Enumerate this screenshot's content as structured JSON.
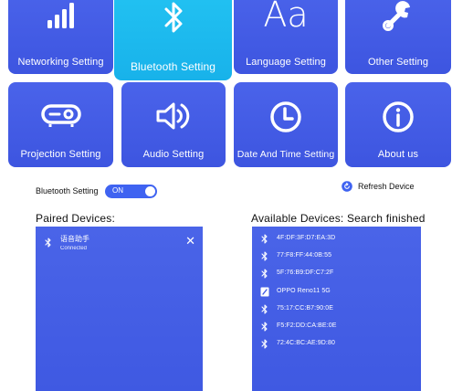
{
  "tiles": [
    {
      "label": "Networking Setting",
      "icon": "signal-bars-icon"
    },
    {
      "label": "Bluetooth Setting",
      "icon": "bluetooth-icon",
      "active": true
    },
    {
      "label": "Language Setting",
      "icon": "language-icon",
      "glyph": "Aa"
    },
    {
      "label": "Other Setting",
      "icon": "wrench-icon"
    },
    {
      "label": "Projection Setting",
      "icon": "projector-icon"
    },
    {
      "label": "Audio Setting",
      "icon": "speaker-icon"
    },
    {
      "label": "Date And Time Setting",
      "icon": "clock-icon"
    },
    {
      "label": "About us",
      "icon": "info-icon"
    }
  ],
  "bluetooth": {
    "label": "Bluetooth Setting",
    "toggle_state": "ON",
    "refresh_label": "Refresh Device"
  },
  "paired": {
    "title": "Paired Devices:",
    "items": [
      {
        "name": "语音助手",
        "status": "Connected"
      }
    ]
  },
  "available": {
    "title": "Available Devices: Search finished",
    "items": [
      {
        "name": "4F:DF:3F:D7:EA:3D",
        "icon": "bluetooth-icon"
      },
      {
        "name": "77:F8:FF:44:0B:55",
        "icon": "bluetooth-icon"
      },
      {
        "name": "5F:76:B9:DF:C7:2F",
        "icon": "bluetooth-icon"
      },
      {
        "name": "OPPO Reno11 5G",
        "icon": "phone-icon"
      },
      {
        "name": "75:17:CC:B7:90:0E",
        "icon": "bluetooth-icon"
      },
      {
        "name": "F5:F2:DD:CA:BE:0E",
        "icon": "bluetooth-icon"
      },
      {
        "name": "72:4C:BC:AE:9D:80",
        "icon": "bluetooth-icon"
      }
    ]
  },
  "colors": {
    "tile": "#4561e8",
    "tile_active": "#1fbdef",
    "panel": "#4560e6",
    "toggle": "#3f63f1"
  }
}
